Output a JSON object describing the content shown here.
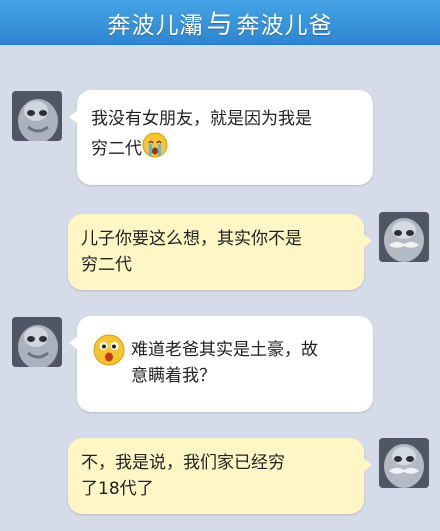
{
  "header": {
    "title_left": "奔波儿灞",
    "title_mid": "与",
    "title_right": "奔波儿爸"
  },
  "colors": {
    "header": "#3596dc",
    "background": "#d6dbe9",
    "incoming_bubble": "#ffffff",
    "outgoing_bubble": "#fff6c6"
  },
  "messages": [
    {
      "sender": "奔波儿灞",
      "side": "left",
      "lines": [
        "我没有女朋友，就是因为我是",
        "穷二代"
      ],
      "emoji": "crying-face-icon"
    },
    {
      "sender": "奔波儿爸",
      "side": "right",
      "lines": [
        "儿子你要这么想，其实你不是",
        "穷二代"
      ]
    },
    {
      "sender": "奔波儿灞",
      "side": "left",
      "lines": [
        "难道老爸其实是土豪，故",
        "意瞒着我？"
      ],
      "emoji": "surprised-face-icon"
    },
    {
      "sender": "奔波儿爸",
      "side": "right",
      "lines": [
        "不，我是说，我们家已经穷",
        "了18代了"
      ]
    }
  ]
}
